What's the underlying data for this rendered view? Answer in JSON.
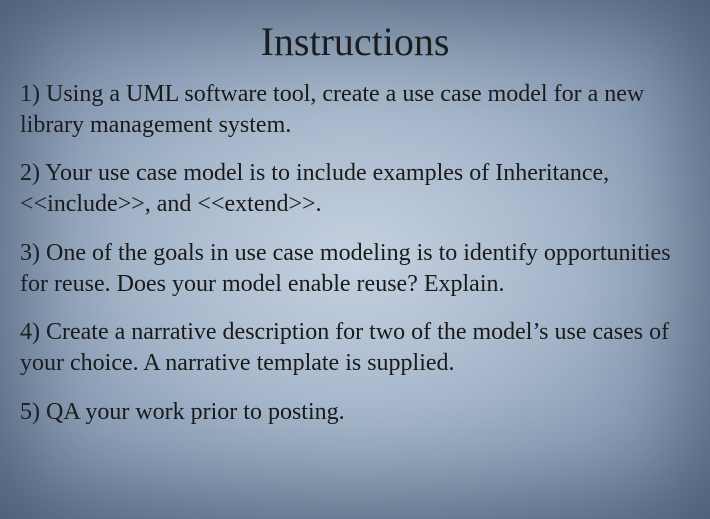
{
  "slide": {
    "title": "Instructions",
    "items": [
      "1) Using a UML software tool, create a use case model for a new library management system.",
      "2) Your use case model is to include examples of Inheritance, <<include>>, and <<extend>>.",
      "3) One of the goals in use case modeling is to identify opportunities for reuse. Does your model enable reuse? Explain.",
      "4) Create a narrative description for two of the model’s use cases of your choice. A narrative template is supplied.",
      "5) QA your work prior to posting."
    ]
  }
}
